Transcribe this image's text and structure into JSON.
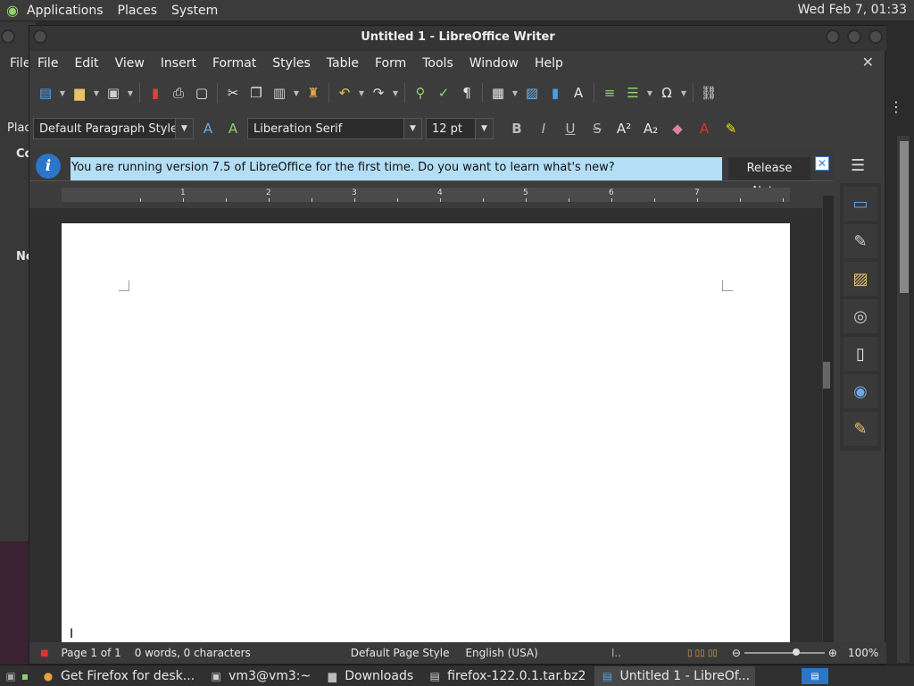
{
  "topbar": {
    "menus": [
      "Applications",
      "Places",
      "System"
    ],
    "clock": "Wed Feb 7, 01:33"
  },
  "background_window": {
    "menu_label": "File",
    "fragments": [
      "Plac",
      "Co",
      "No"
    ]
  },
  "window": {
    "title": "Untitled 1 - LibreOffice Writer"
  },
  "menubar": [
    "File",
    "Edit",
    "View",
    "Insert",
    "Format",
    "Styles",
    "Table",
    "Form",
    "Tools",
    "Window",
    "Help"
  ],
  "close_doc_glyph": "✕",
  "toolbar1": [
    {
      "name": "new-icon",
      "glyph": "▤",
      "color": "#5aa0e6",
      "arrow": true
    },
    {
      "name": "open-icon",
      "glyph": "▆",
      "color": "#e9c06b",
      "arrow": true
    },
    {
      "name": "save-icon",
      "glyph": "▣",
      "color": "#cfcfcf",
      "arrow": true
    },
    {
      "name": "export-pdf-icon",
      "glyph": "▮",
      "color": "#d9443a",
      "arrow": false
    },
    {
      "name": "print-icon",
      "glyph": "⎙",
      "color": "#e6e6e6",
      "arrow": false
    },
    {
      "name": "print-preview-icon",
      "glyph": "▢",
      "color": "#e6e6e6",
      "arrow": false
    },
    {
      "name": "cut-icon",
      "glyph": "✂",
      "color": "#e6e6e6",
      "arrow": false
    },
    {
      "name": "copy-icon",
      "glyph": "❐",
      "color": "#e6e6e6",
      "arrow": false
    },
    {
      "name": "paste-icon",
      "glyph": "▥",
      "color": "#cfcfcf",
      "arrow": true
    },
    {
      "name": "clone-formatting-icon",
      "glyph": "♜",
      "color": "#e8a64a",
      "arrow": false
    },
    {
      "name": "undo-icon",
      "glyph": "↶",
      "color": "#e8c04a",
      "arrow": true
    },
    {
      "name": "redo-icon",
      "glyph": "↷",
      "color": "#dddddd",
      "arrow": true
    },
    {
      "name": "find-replace-icon",
      "glyph": "⚲",
      "color": "#8fd36b",
      "arrow": false
    },
    {
      "name": "spelling-icon",
      "glyph": "✓",
      "color": "#8fd36b",
      "arrow": false
    },
    {
      "name": "formatting-marks-icon",
      "glyph": "¶",
      "color": "#e6e6e6",
      "arrow": false
    },
    {
      "name": "insert-table-icon",
      "glyph": "▦",
      "color": "#e6e6e6",
      "arrow": true
    },
    {
      "name": "insert-image-icon",
      "glyph": "▨",
      "color": "#6fb3e6",
      "arrow": false
    },
    {
      "name": "insert-chart-icon",
      "glyph": "▮",
      "color": "#4aa0e6",
      "arrow": false
    },
    {
      "name": "insert-textbox-icon",
      "glyph": "A",
      "color": "#e6e6e6",
      "arrow": false
    },
    {
      "name": "insert-page-break-icon",
      "glyph": "≡",
      "color": "#8fd36b",
      "arrow": false
    },
    {
      "name": "insert-field-icon",
      "glyph": "☰",
      "color": "#8fd36b",
      "arrow": true
    },
    {
      "name": "special-character-icon",
      "glyph": "Ω",
      "color": "#e6e6e6",
      "arrow": true
    },
    {
      "name": "hyperlink-icon",
      "glyph": "⛓",
      "color": "#e6e6e6",
      "arrow": false
    }
  ],
  "toolbar2": {
    "paragraph_style": "Default Paragraph Style",
    "font_name": "Liberation Serif",
    "font_size": "12 pt",
    "buttons": [
      {
        "name": "update-style-icon",
        "glyph": "A",
        "color": "#6fa8e6"
      },
      {
        "name": "new-style-icon",
        "glyph": "A",
        "color": "#8fd36b"
      },
      {
        "name": "bold-icon",
        "glyph": "B",
        "color": "#bbbbbb"
      },
      {
        "name": "italic-icon",
        "glyph": "I",
        "color": "#bbbbbb"
      },
      {
        "name": "underline-icon",
        "glyph": "U",
        "color": "#bbbbbb"
      },
      {
        "name": "strikethrough-icon",
        "glyph": "S",
        "color": "#bbbbbb"
      },
      {
        "name": "superscript-icon",
        "glyph": "A²",
        "color": "#e6e6e6"
      },
      {
        "name": "subscript-icon",
        "glyph": "A₂",
        "color": "#e6e6e6"
      },
      {
        "name": "clear-formatting-icon",
        "glyph": "◆",
        "color": "#e080a0"
      },
      {
        "name": "font-color-icon",
        "glyph": "A",
        "color": "#e03030"
      },
      {
        "name": "highlight-icon",
        "glyph": "✎",
        "color": "#e8e020"
      }
    ]
  },
  "infobar": {
    "message": "You are running version 7.5 of LibreOffice for the first time. Do you want to learn what's new?",
    "button": "Release Notes",
    "info_glyph": "i",
    "close_glyph": "✕"
  },
  "sidebar_menu_glyph": "☰",
  "ruler_numbers": [
    "1",
    "2",
    "3",
    "4",
    "5",
    "6",
    "7"
  ],
  "deck_icons": [
    {
      "name": "properties-icon",
      "glyph": "▭",
      "color": "#5aa0e6"
    },
    {
      "name": "styles-icon",
      "glyph": "✎",
      "color": "#cfcfcf"
    },
    {
      "name": "gallery-icon",
      "glyph": "▨",
      "color": "#e9c06b"
    },
    {
      "name": "navigator-icon",
      "glyph": "◎",
      "color": "#cfcfcf"
    },
    {
      "name": "page-icon",
      "glyph": "▯",
      "color": "#eeeeee"
    },
    {
      "name": "style-inspector-icon",
      "glyph": "◉",
      "color": "#6fa8e6"
    },
    {
      "name": "manage-changes-icon",
      "glyph": "✎",
      "color": "#e9c06b"
    }
  ],
  "statusbar": {
    "page": "Page 1 of 1",
    "words": "0 words, 0 characters",
    "page_style": "Default Page Style",
    "language": "English (USA)",
    "zoom": "100%"
  },
  "taskbar": [
    {
      "label": "Get Firefox for desk...",
      "icon": "chrome-icon",
      "glyph": "●",
      "color": "#e6a23c",
      "active": false
    },
    {
      "label": "vm3@vm3:~",
      "icon": "terminal-icon",
      "glyph": "▣",
      "color": "#cfcfcf",
      "active": false
    },
    {
      "label": "Downloads",
      "icon": "folder-icon",
      "glyph": "▆",
      "color": "#bbbbbb",
      "active": false
    },
    {
      "label": "firefox-122.0.1.tar.bz2",
      "icon": "archive-icon",
      "glyph": "▤",
      "color": "#cfcfcf",
      "active": false
    },
    {
      "label": "Untitled 1 - LibreOf...",
      "icon": "writer-icon",
      "glyph": "▤",
      "color": "#5aa0e6",
      "active": true
    }
  ]
}
